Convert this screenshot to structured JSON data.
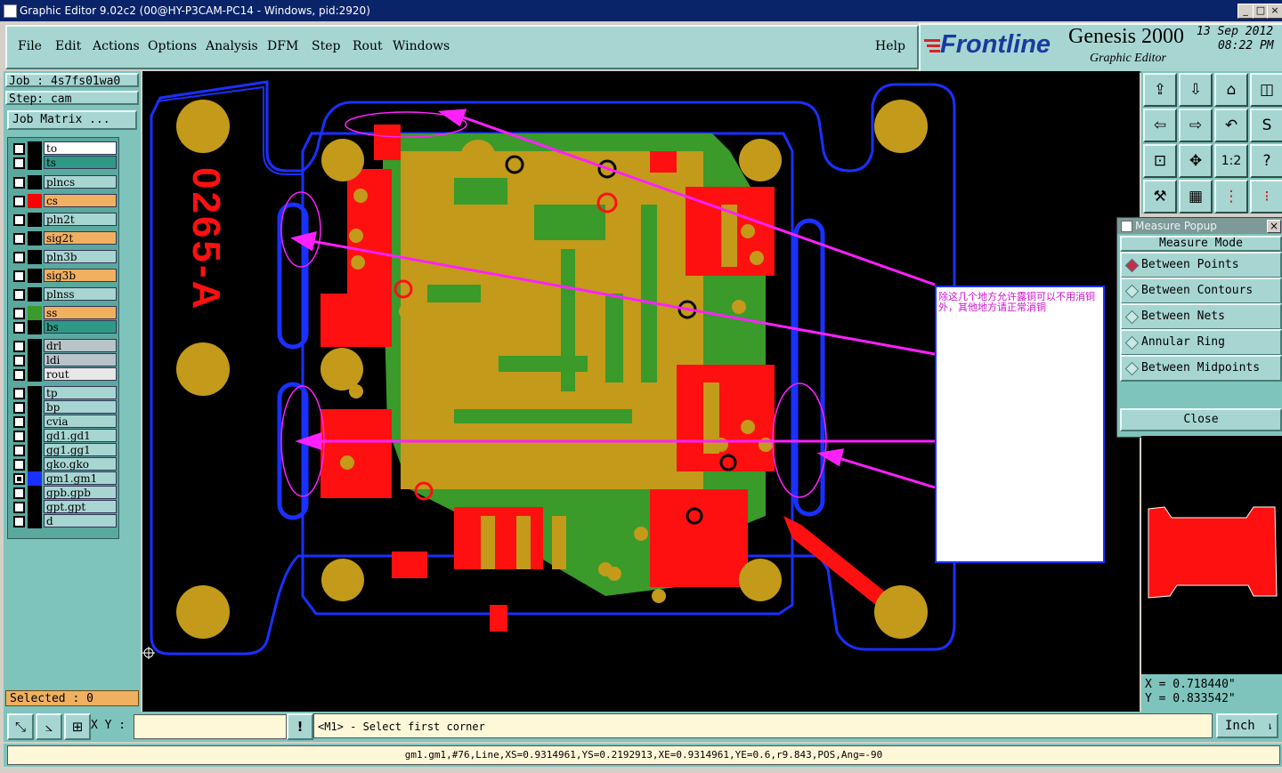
{
  "window": {
    "title": "Graphic Editor 9.02c2 (00@HY-P3CAM-PC14 - Windows, pid:2920)"
  },
  "menu": [
    "File",
    "Edit",
    "Actions",
    "Options",
    "Analysis",
    "DFM",
    "Step",
    "Rout",
    "Windows"
  ],
  "help_label": "Help",
  "brand": {
    "logo": "Frontline",
    "product": "Genesis 2000",
    "subtitle": "Graphic Editor",
    "date": "13 Sep 2012",
    "time": "08:22 PM"
  },
  "job": {
    "job_label": "Job : 4s7fs01wa0",
    "step_label": "Step: cam",
    "matrix_button": "Job Matrix ..."
  },
  "layers": [
    {
      "name": "to",
      "color": "#ffffff",
      "swatch": "#000000",
      "state": "editable"
    },
    {
      "name": "ts",
      "color": "#2e9a86",
      "swatch": "#000000"
    },
    {
      "name": "plncs",
      "color": "#a7d6d2",
      "swatch": "#000000"
    },
    {
      "name": "cs",
      "color": "#f0b060",
      "swatch": "#ff0000"
    },
    {
      "name": "pln2t",
      "color": "#a7d6d2",
      "swatch": "#000000"
    },
    {
      "name": "sig2t",
      "color": "#f0b060",
      "swatch": "#000000"
    },
    {
      "name": "pln3b",
      "color": "#a7d6d2",
      "swatch": "#000000"
    },
    {
      "name": "sig3b",
      "color": "#f0b060",
      "swatch": "#000000"
    },
    {
      "name": "plnss",
      "color": "#a7d6d2",
      "swatch": "#000000"
    },
    {
      "name": "ss",
      "color": "#f0b060",
      "swatch": "#3a9a2a"
    },
    {
      "name": "bs",
      "color": "#2e9a86",
      "swatch": "#000000"
    },
    {
      "name": "drl",
      "color": "#b8c4c8",
      "swatch": "#000000"
    },
    {
      "name": "ldi",
      "color": "#b8c4c8",
      "swatch": "#000000"
    },
    {
      "name": "rout",
      "color": "#e8e8e8",
      "swatch": "#000000"
    },
    {
      "name": "tp",
      "color": "#a7d6d2",
      "swatch": "#000000"
    },
    {
      "name": "bp",
      "color": "#a7d6d2",
      "swatch": "#000000"
    },
    {
      "name": "cvia",
      "color": "#a7d6d2",
      "swatch": "#000000"
    },
    {
      "name": "gd1.gd1",
      "color": "#a7d6d2",
      "swatch": "#000000"
    },
    {
      "name": "gg1.gg1",
      "color": "#a7d6d2",
      "swatch": "#000000"
    },
    {
      "name": "gko.gko",
      "color": "#a7d6d2",
      "swatch": "#000000"
    },
    {
      "name": "gm1.gm1",
      "color": "#a7d6d2",
      "swatch": "#1a30ff",
      "state": "work"
    },
    {
      "name": "gpb.gpb",
      "color": "#a7d6d2",
      "swatch": "#000000"
    },
    {
      "name": "gpt.gpt",
      "color": "#a7d6d2",
      "swatch": "#000000"
    },
    {
      "name": "d",
      "color": "#a7d6d2",
      "swatch": "#000000"
    }
  ],
  "selected_label": "Selected : 0",
  "board": {
    "silk_text": "0265-A",
    "note": "除这几个地方允许露铜可以不用消铜外，其他地方请正常消铜"
  },
  "measure": {
    "title": "Measure Popup",
    "mode_label": "Measure Mode",
    "options": [
      "Between Points",
      "Between Contours",
      "Between Nets",
      "Annular Ring",
      "Between Midpoints"
    ],
    "selected": 0,
    "close_label": "Close"
  },
  "coords": {
    "x": "X = 0.718440\"",
    "y": "Y = 0.833542\""
  },
  "bottom": {
    "xy_label": "X Y :",
    "xy_value": "",
    "prompt": "<M1> - Select first corner",
    "units": "Inch"
  },
  "status": "gm1.gm1,#76,Line,XS=0.9314961,YS=0.2192913,XE=0.9314961,YE=0.6,r9.843,POS,Ang=-90",
  "colors": {
    "panel": "#7fc4bc",
    "button": "#a7d6d2",
    "copper": "#c39a1a",
    "mask": "#3a9a2a",
    "red": "#ff1010",
    "outline": "#1a30ff",
    "annotation": "#ff20ff"
  }
}
